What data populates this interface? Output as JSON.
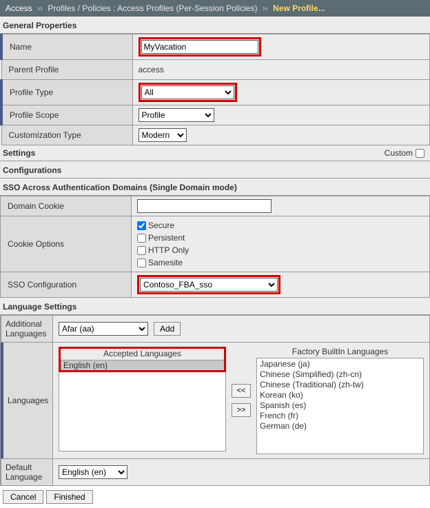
{
  "breadcrumb": {
    "root": "Access",
    "path": "Profiles / Policies : Access Profiles (Per-Session Policies)",
    "current": "New Profile..."
  },
  "general": {
    "title": "General Properties",
    "rows": {
      "name_label": "Name",
      "name_value": "MyVacation",
      "parent_label": "Parent Profile",
      "parent_value": "access",
      "type_label": "Profile Type",
      "type_value": "All",
      "scope_label": "Profile Scope",
      "scope_value": "Profile",
      "custom_label": "Customization Type",
      "custom_value": "Modern"
    }
  },
  "settings": {
    "title": "Settings",
    "custom_label": "Custom"
  },
  "configurations": {
    "title": "Configurations"
  },
  "sso": {
    "title": "SSO Across Authentication Domains (Single Domain mode)",
    "domain_cookie_label": "Domain Cookie",
    "domain_cookie_value": "",
    "cookie_options_label": "Cookie Options",
    "opts": {
      "secure": "Secure",
      "persistent": "Persistent",
      "httponly": "HTTP Only",
      "samesite": "Samesite"
    },
    "sso_config_label": "SSO Configuration",
    "sso_config_value": "Contoso_FBA_sso"
  },
  "lang": {
    "title": "Language Settings",
    "additional_label": "Additional Languages",
    "additional_value": "Afar (aa)",
    "add_button": "Add",
    "languages_label": "Languages",
    "accepted_title": "Accepted Languages",
    "factory_title": "Factory BuiltIn Languages",
    "accepted_items": [
      "English (en)"
    ],
    "factory_items": [
      "Japanese (ja)",
      "Chinese (Simplified) (zh-cn)",
      "Chinese (Traditional) (zh-tw)",
      "Korean (ko)",
      "Spanish (es)",
      "French (fr)",
      "German (de)"
    ],
    "move_left": "<<",
    "move_right": ">>",
    "default_label": "Default Language",
    "default_value": "English (en)"
  },
  "footer": {
    "cancel": "Cancel",
    "finished": "Finished"
  }
}
